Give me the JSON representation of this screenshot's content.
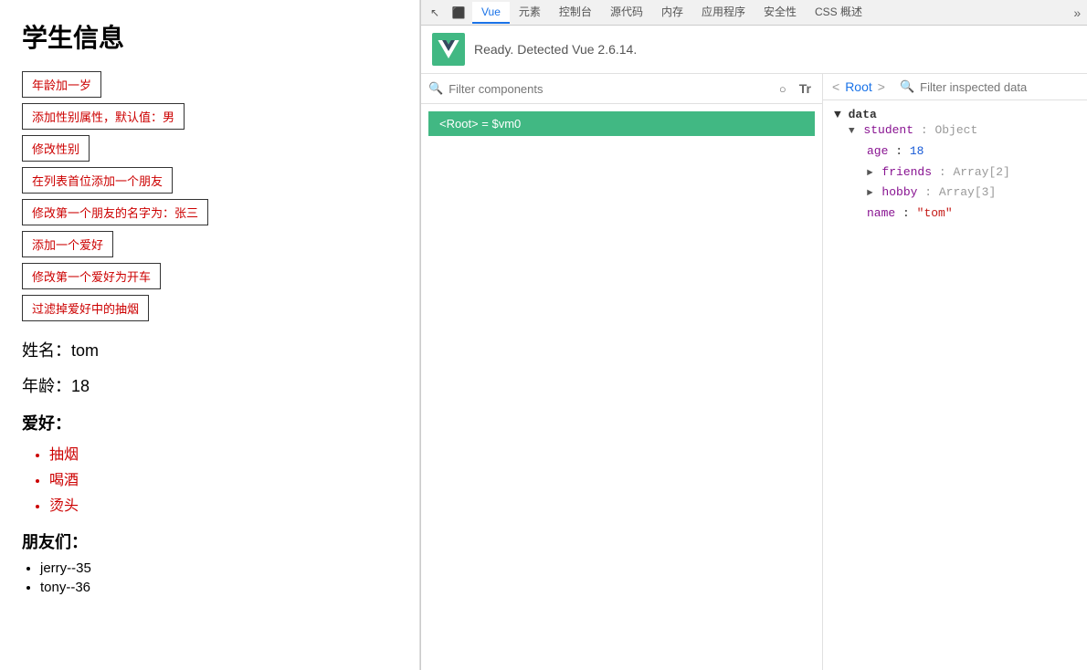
{
  "leftPanel": {
    "title": "学生信息",
    "buttons": [
      {
        "id": "btn-age",
        "label": "年龄加一岁"
      },
      {
        "id": "btn-gender-attr",
        "label": "添加性别属性，默认值：男"
      },
      {
        "id": "btn-change-gender",
        "label": "修改性别"
      },
      {
        "id": "btn-add-friend",
        "label": "在列表首位添加一个朋友"
      },
      {
        "id": "btn-rename-friend",
        "label": "修改第一个朋友的名字为：张三"
      },
      {
        "id": "btn-add-hobby",
        "label": "添加一个爱好"
      },
      {
        "id": "btn-change-hobby",
        "label": "修改第一个爱好为开车"
      },
      {
        "id": "btn-filter-hobby",
        "label": "过滤掉爱好中的抽烟"
      }
    ],
    "studentInfo": {
      "nameLabel": "姓名：",
      "nameValue": "tom",
      "ageLabel": "年龄：",
      "ageValue": "18",
      "hobbiesLabel": "爱好：",
      "hobbies": [
        "抽烟",
        "喝酒",
        "烫头"
      ],
      "friendsLabel": "朋友们：",
      "friends": [
        "jerry--35",
        "tony--36"
      ]
    }
  },
  "devtools": {
    "tabs": [
      {
        "id": "tab-cursor",
        "label": "↖"
      },
      {
        "id": "tab-inspect",
        "label": "⬛"
      },
      {
        "id": "tab-vue",
        "label": "Vue",
        "active": true
      },
      {
        "id": "tab-elements",
        "label": "元素"
      },
      {
        "id": "tab-console",
        "label": "控制台"
      },
      {
        "id": "tab-sources",
        "label": "源代码"
      },
      {
        "id": "tab-memory",
        "label": "内存"
      },
      {
        "id": "tab-app",
        "label": "应用程序"
      },
      {
        "id": "tab-security",
        "label": "安全性"
      },
      {
        "id": "tab-css",
        "label": "CSS 概述"
      }
    ],
    "vueBanner": {
      "logoText": "V",
      "readyText": "Ready. Detected Vue 2.6.14."
    },
    "componentsPanel": {
      "filterPlaceholder": "Filter components",
      "filterIconLabel": "⚙",
      "sortIconLabel": "Tt",
      "rootItem": "<Root> = $vm0"
    },
    "inspectorPanel": {
      "rootLabel": "<Root>",
      "filterPlaceholder": "Filter inspected data",
      "dataTree": {
        "rootKey": "data",
        "children": [
          {
            "key": "student",
            "type": "Object",
            "expanded": true,
            "children": [
              {
                "key": "age",
                "value": "18",
                "valueType": "num"
              },
              {
                "key": "friends",
                "type": "Array[2]",
                "expandable": true
              },
              {
                "key": "hobby",
                "type": "Array[3]",
                "expandable": true
              },
              {
                "key": "name",
                "value": "\"tom\"",
                "valueType": "str"
              }
            ]
          }
        ]
      }
    }
  }
}
